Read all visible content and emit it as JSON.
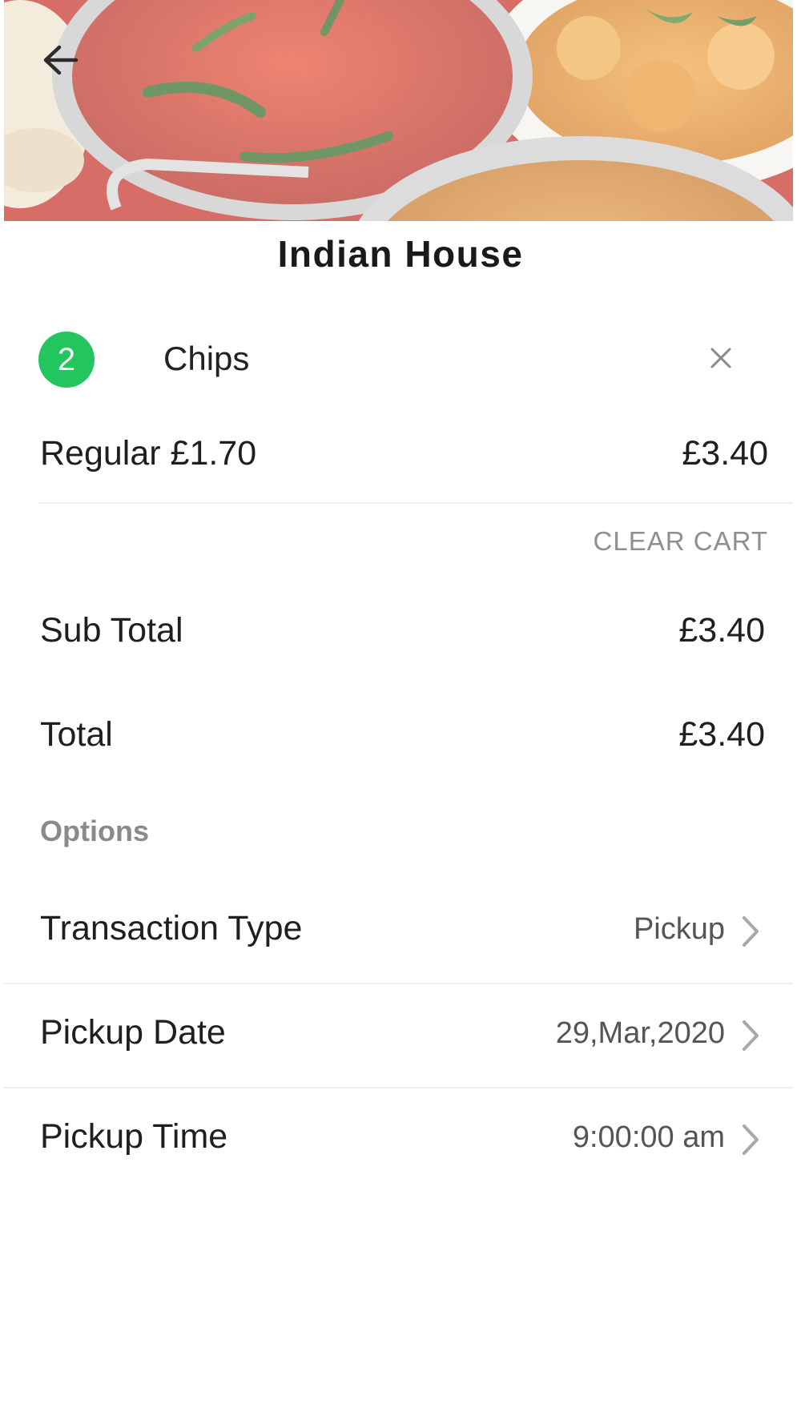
{
  "restaurant": {
    "name": "Indian House"
  },
  "cart": {
    "item": {
      "quantity": "2",
      "name": "Chips",
      "variant_price": "Regular £1.70",
      "line_total": "£3.40"
    },
    "clear_label": "CLEAR CART"
  },
  "totals": {
    "subtotal_label": "Sub Total",
    "subtotal_value": "£3.40",
    "total_label": "Total",
    "total_value": "£3.40"
  },
  "options": {
    "heading": "Options",
    "rows": [
      {
        "label": "Transaction Type",
        "value": "Pickup"
      },
      {
        "label": "Pickup Date",
        "value": "29,Mar,2020"
      },
      {
        "label": "Pickup Time",
        "value": "9:00:00 am"
      }
    ]
  },
  "icons": {
    "back": "arrow-left-icon",
    "remove": "close-icon",
    "disclosure": "chevron-right-icon"
  },
  "colors": {
    "badge": "#22c55e",
    "muted": "#8f8f8f"
  }
}
